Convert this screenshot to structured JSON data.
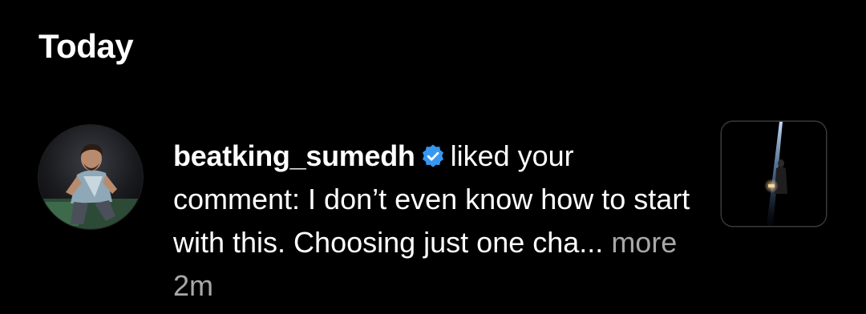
{
  "section": {
    "title": "Today"
  },
  "notification": {
    "username": "beatking_sumedh",
    "action": "liked your comment: I don’t even know how to start with this. Choosing just one cha...",
    "more_label": "more",
    "timestamp": "2m",
    "verified_icon": "verified-badge-icon",
    "verified_color": "#3897f0",
    "avatar": "avatar-photo",
    "thumbnail": "post-thumbnail-photo"
  }
}
